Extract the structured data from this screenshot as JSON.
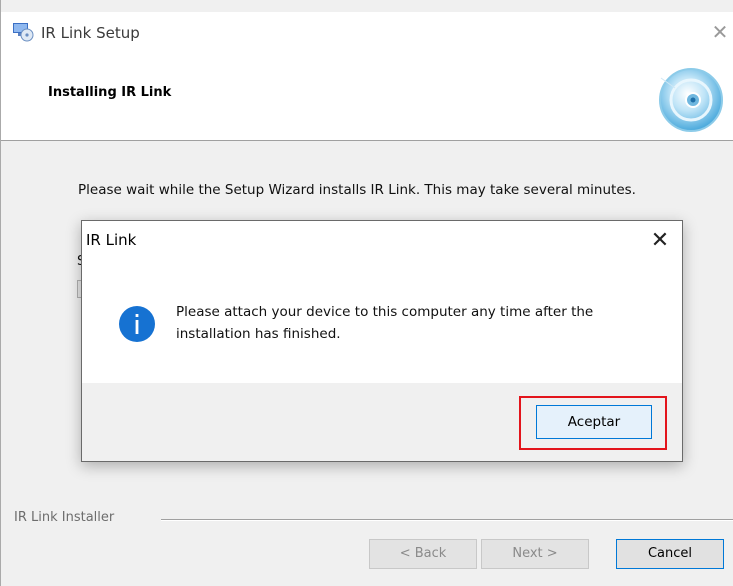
{
  "setup_window": {
    "title": "IR Link Setup",
    "close_glyph": "✕",
    "header_title": "Installing IR Link",
    "description": "Please wait while the Setup Wizard installs IR Link.  This may take several minutes.",
    "hidden_status_text": "S",
    "group_label": "IR Link Installer",
    "buttons": {
      "back": "< Back",
      "next": "Next >",
      "cancel": "Cancel"
    },
    "icons": {
      "app": "computer-disc-icon",
      "header_graphic": "cd-disc-icon"
    }
  },
  "message_box": {
    "title": "IR Link",
    "close_glyph": "✕",
    "message": "Please attach your device to this computer any time after the installation has finished.",
    "ok_label": "Aceptar",
    "icon": "info-icon",
    "highlight_color": "#e3141b",
    "accent_color": "#0078d7"
  }
}
